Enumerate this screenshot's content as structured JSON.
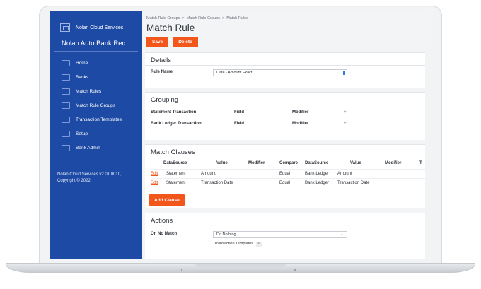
{
  "sidebar": {
    "brand": "Nolan Cloud Services",
    "app_title": "Nolan Auto Bank Rec",
    "items": [
      {
        "label": "Home"
      },
      {
        "label": "Banks"
      },
      {
        "label": "Match Rules"
      },
      {
        "label": "Match Rule Groups"
      },
      {
        "label": "Transaction Templates"
      },
      {
        "label": "Setup"
      },
      {
        "label": "Bank Admin"
      }
    ],
    "version": "Nolan Cloud Services v2.01.0010,",
    "copyright": "Copyright © 2022"
  },
  "breadcrumb": {
    "items": [
      "Match Rule Groups",
      ">",
      "Match Rule Groups",
      ">",
      "Match Rules"
    ]
  },
  "page": {
    "title": "Match Rule",
    "save_label": "Save",
    "delete_label": "Delete"
  },
  "details": {
    "title": "Details",
    "rule_name_label": "Rule Name",
    "rule_name_value": "Date - Amount Exact"
  },
  "grouping": {
    "title": "Grouping",
    "rows": [
      {
        "label": "Statement Transaction",
        "field": "Field",
        "modifier": "Modifier",
        "plus": "+"
      },
      {
        "label": "Bank Ledger Transaction",
        "field": "Field",
        "modifier": "Modifier",
        "plus": "+"
      }
    ]
  },
  "match_clauses": {
    "title": "Match Clauses",
    "headers": [
      "DataSource",
      "Value",
      "Modifier",
      "Compare",
      "DataSource",
      "Value",
      "Modifier",
      "T"
    ],
    "rows": [
      {
        "edit": "Edit",
        "ds1": "Statement",
        "val1": "Amount",
        "compare": "Equal",
        "ds2": "Bank Ledger",
        "val2": "Amount"
      },
      {
        "edit": "Edit",
        "ds1": "Statement",
        "val1": "Transaction Date",
        "compare": "Equal",
        "ds2": "Bank Ledger",
        "val2": "Transaction Date"
      }
    ],
    "add_label": "Add Clause"
  },
  "actions": {
    "title": "Actions",
    "on_no_match_label": "On No Match",
    "on_no_match_value": "Do Nothing",
    "template_chip": "Transaction Templates",
    "template_chip_x": "×"
  },
  "colors": {
    "sidebar": "#1d4aa4",
    "accent": "#f3561b"
  }
}
